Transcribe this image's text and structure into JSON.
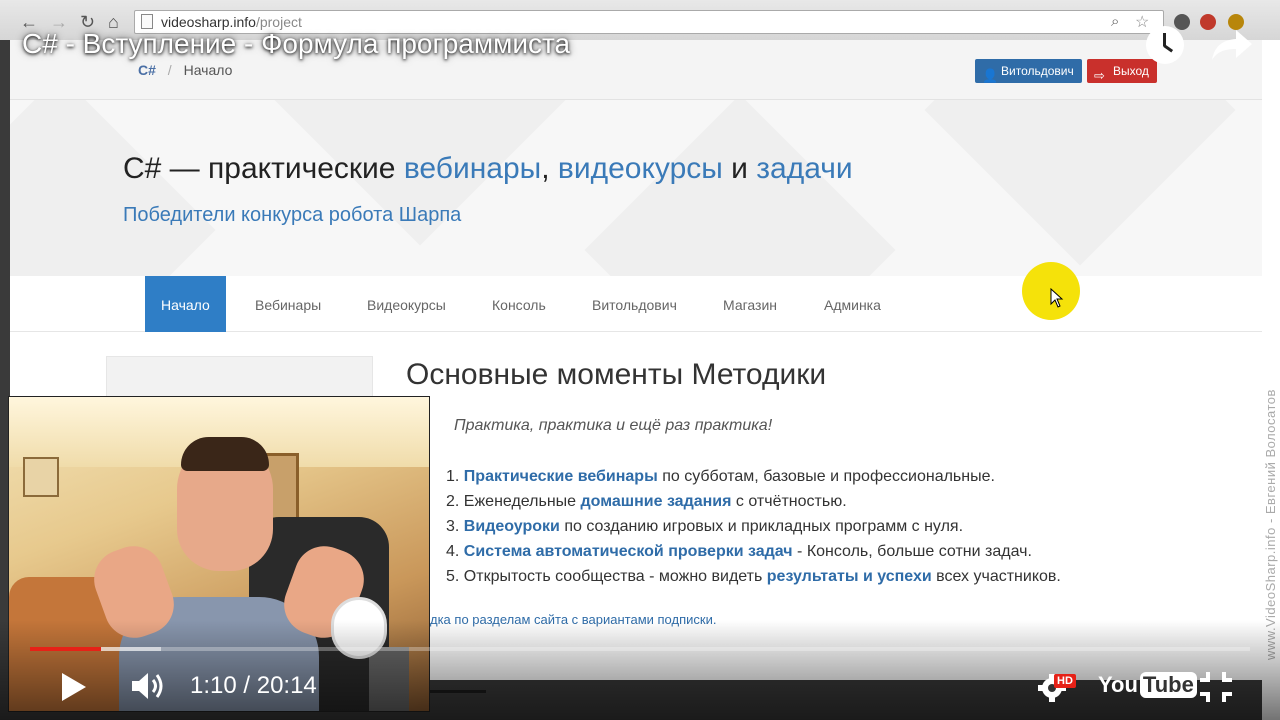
{
  "browser": {
    "url_host": "videosharp.info",
    "url_path": "/project"
  },
  "site": {
    "breadcrumb": {
      "root": "C#",
      "separator": "/",
      "current": "Начало"
    },
    "user_button": "Витольдович",
    "exit_button": "Выход",
    "hero": {
      "title_prefix": "C# — практические ",
      "link_webinars": "вебинары",
      "comma": ", ",
      "link_courses": "видеокурсы",
      "and": " и ",
      "link_tasks": "задачи",
      "subtitle": "Победители конкурса робота Шарпа"
    },
    "menu": [
      "Начало",
      "Вебинары",
      "Видеокурсы",
      "Консоль",
      "Витольдович",
      "Магазин",
      "Админка"
    ],
    "content": {
      "title": "Основные моменты Методики",
      "motto": "Практика, практика и ещё раз практика!",
      "points": [
        {
          "num": "1.",
          "link": "Практические вебинары",
          "rest": " по субботам, базовые и профессиональные."
        },
        {
          "num": "2.",
          "pre": "Еженедельные ",
          "link": "домашние задания",
          "rest": " с отчётностью."
        },
        {
          "num": "3.",
          "link": "Видеоуроки",
          "rest": " по созданию игровых и прикладных программ с нуля."
        },
        {
          "num": "4.",
          "link": "Система автоматической проверки задач",
          "rest": " - Консоль, больше сотни задач."
        },
        {
          "num": "5.",
          "pre": "Открытость сообщества - можно видеть ",
          "link": "результаты и успехи",
          "rest": " всех участников."
        }
      ],
      "note": "дка по разделам сайта с вариантами подписки."
    }
  },
  "video": {
    "title": "C# - Вступление - Формула программиста",
    "time": "1:10 / 20:14",
    "progress_played": 0.058,
    "progress_buffered": 0.107,
    "hd": "HD",
    "logo_you": "You",
    "logo_tube": "Tube",
    "watermark": "www.VideoSharp.info - Евгений Волосатов",
    "colors": {
      "played": "#e62117",
      "accent": "#2f7ec6"
    }
  }
}
